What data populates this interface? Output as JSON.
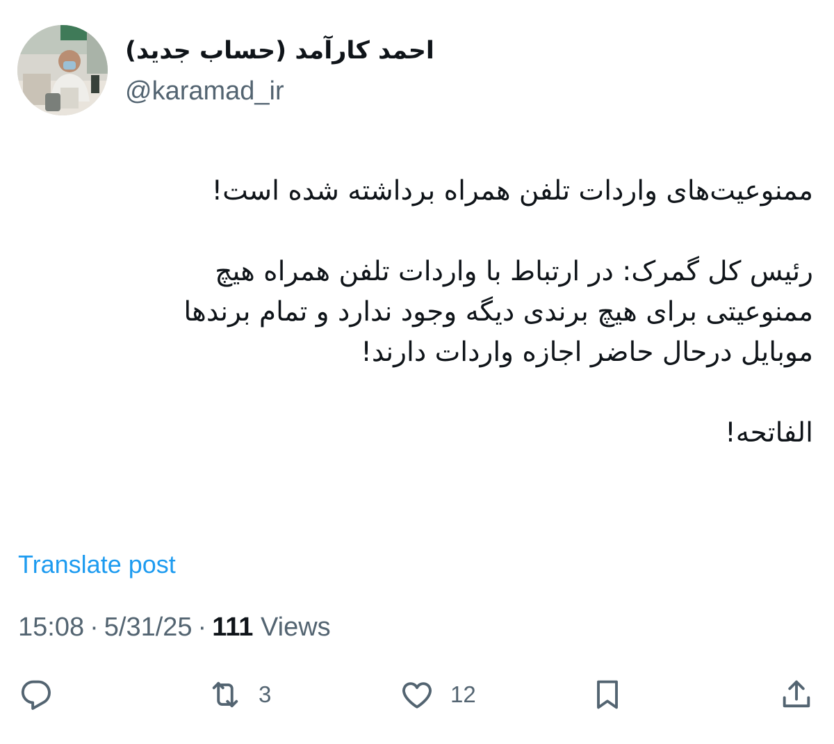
{
  "author": {
    "display_name": "احمد کارآمد (حساب جدید)",
    "handle": "@karamad_ir"
  },
  "tweet": {
    "line1": "ممنوعیت‌های واردات تلفن همراه برداشته شده است!",
    "para2_line1": "رئیس کل گمرک: در ارتباط با واردات تلفن همراه هیچ",
    "para2_line2": "ممنوعیتی برای هیچ برندی دیگه وجود ندارد و تمام برندها",
    "para2_line3": "موبایل درحال حاضر اجازه واردات دارند!",
    "line_last": "الفاتحه!"
  },
  "translate_label": "Translate post",
  "meta": {
    "time": "15:08",
    "date": "5/31/25",
    "views_count": "111",
    "views_label": "Views",
    "separator": "·"
  },
  "actions": {
    "reply_icon": "speech-bubble-icon",
    "retweet_icon": "retweet-arrows-icon",
    "retweet_count": "3",
    "like_icon": "heart-icon",
    "like_count": "12",
    "bookmark_icon": "bookmark-icon",
    "share_icon": "share-upload-icon"
  },
  "colors": {
    "text": "#0f1419",
    "secondary": "#536471",
    "link": "#1d9bf0",
    "background": "#ffffff"
  }
}
